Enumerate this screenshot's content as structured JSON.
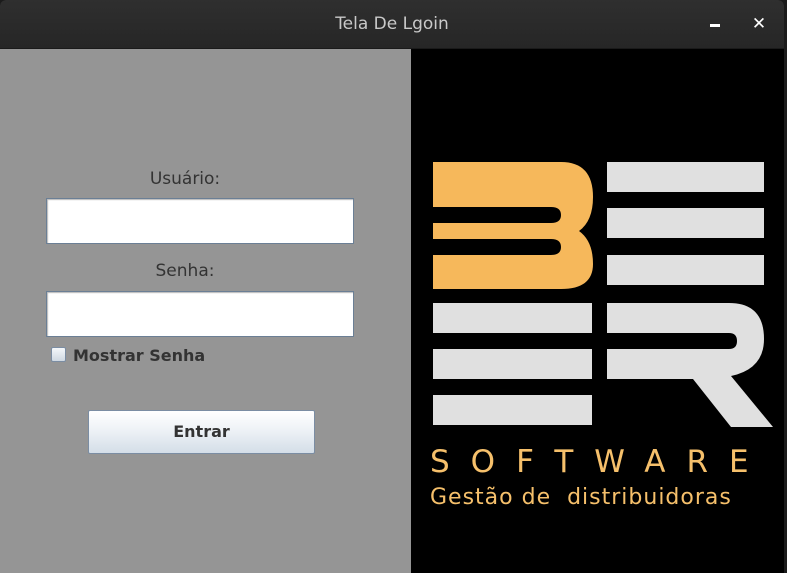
{
  "window": {
    "title": "Tela De Lgoin",
    "minimize_icon": "minimize-icon",
    "close_glyph": "✕"
  },
  "form": {
    "username_label": "Usuário:",
    "username_value": "",
    "password_label": "Senha:",
    "password_value": "",
    "show_password_label": "Mostrar Senha",
    "show_password_checked": false,
    "submit_label": "Entrar"
  },
  "logo": {
    "brand": "SOFTWARE",
    "tagline": "Gestão de  distribuidoras",
    "accent_color": "#f6b85b",
    "bar_color": "#e0e0e0"
  },
  "colors": {
    "left_panel_bg": "#959595",
    "right_panel_bg": "#000000",
    "titlebar_bg": "#2a2a2a"
  }
}
